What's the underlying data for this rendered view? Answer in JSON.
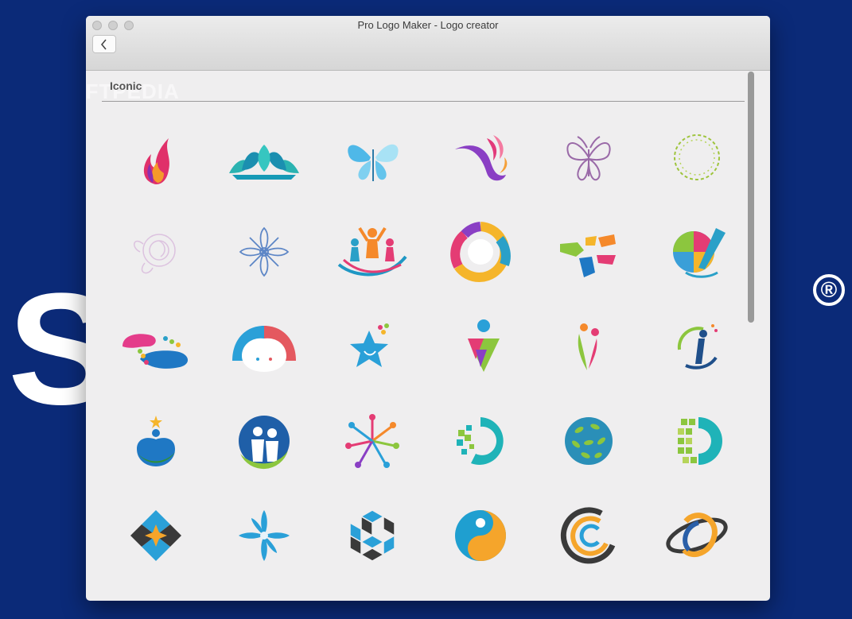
{
  "background": {
    "brand_word": "S            A",
    "registered_mark": "®",
    "color": "#0b2a78"
  },
  "window": {
    "title": "Pro Logo Maker - Logo creator",
    "back_label": "<"
  },
  "watermark": "SOFTPEDIA",
  "section": {
    "title": "Iconic"
  },
  "logos": [
    {
      "name": "flame-icon"
    },
    {
      "name": "lotus-icon"
    },
    {
      "name": "blue-butterfly-icon"
    },
    {
      "name": "wave-swirl-icon"
    },
    {
      "name": "outline-butterfly-icon"
    },
    {
      "name": "leaf-wreath-icon"
    },
    {
      "name": "rose-outline-icon"
    },
    {
      "name": "mandala-icon"
    },
    {
      "name": "people-cheer-icon"
    },
    {
      "name": "rainbow-face-icon"
    },
    {
      "name": "hands-icon"
    },
    {
      "name": "paint-globe-icon"
    },
    {
      "name": "feet-icon"
    },
    {
      "name": "hair-face-icon"
    },
    {
      "name": "star-face-icon"
    },
    {
      "name": "person-triangle-icon"
    },
    {
      "name": "two-people-icon"
    },
    {
      "name": "swoosh-person-icon"
    },
    {
      "name": "star-person-icon"
    },
    {
      "name": "family-circle-icon"
    },
    {
      "name": "team-circle-icon"
    },
    {
      "name": "pixel-circle-icon"
    },
    {
      "name": "leaf-sphere-icon"
    },
    {
      "name": "pixel-letter-icon"
    },
    {
      "name": "diamond-star-icon"
    },
    {
      "name": "flower-star-icon"
    },
    {
      "name": "cube-hex-icon"
    },
    {
      "name": "yin-swirl-icon"
    },
    {
      "name": "ring-swirl-icon"
    },
    {
      "name": "orbit-icon"
    }
  ]
}
